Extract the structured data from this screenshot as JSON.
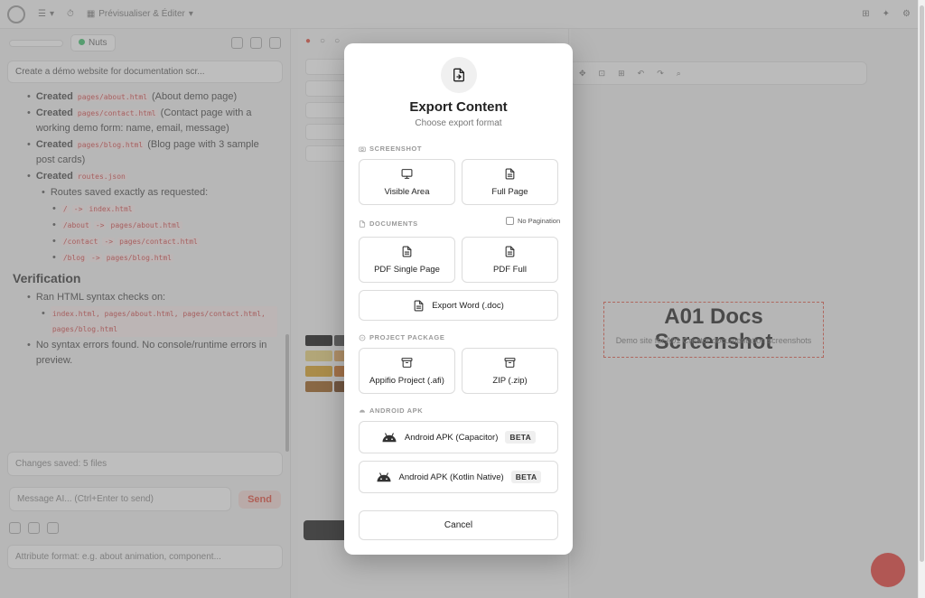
{
  "app": {
    "topbar": [
      "Prévisualiser & Éditer"
    ],
    "left": {
      "model_select": "",
      "status_label": "Nuts",
      "session_title": "Create a démo website for documentation scr...",
      "chat": {
        "created_items": [
          {
            "label": "Created",
            "file": "pages/about.html",
            "note": "(About demo page)"
          },
          {
            "label": "Created",
            "file": "pages/contact.html",
            "note": "(Contact page with a working demo form: name, email, message)"
          },
          {
            "label": "Created",
            "file": "pages/blog.html",
            "note": "(Blog page with 3 sample post cards)"
          },
          {
            "label": "Created",
            "file": "routes.json"
          }
        ],
        "routes_intro": "Routes saved exactly as requested:",
        "routes": [
          {
            "path": "/",
            "arrow": "->",
            "file": "index.html"
          },
          {
            "path": "/about",
            "arrow": "->",
            "file": "pages/about.html"
          },
          {
            "path": "/contact",
            "arrow": "->",
            "file": "pages/contact.html"
          },
          {
            "path": "/blog",
            "arrow": "->",
            "file": "pages/blog.html"
          }
        ],
        "verification_heading": "Verification",
        "verify_items": [
          "Ran HTML syntax checks on:",
          "No syntax errors found. No console/runtime errors in preview."
        ],
        "verify_files": "index.html, pages/about.html, pages/contact.html, pages/blog.html"
      },
      "changes_label": "Changes saved: 5 files",
      "input_placeholder": "Message AI... (Ctrl+Enter to send)",
      "send_label": "Send",
      "bottom_note": "Attribute format: e.g. about animation, component..."
    },
    "canvas": {
      "heading": "A01 Docs Screenshot",
      "sub": "Demo site for A01 Creator documentation screenshots"
    }
  },
  "modal": {
    "title": "Export Content",
    "subtitle": "Choose export format",
    "sections": {
      "screenshot": "SCREENSHOT",
      "documents": "DOCUMENTS",
      "project_package": "PROJECT PACKAGE",
      "android_apk": "ANDROID APK"
    },
    "no_pagination_label": "No Pagination",
    "options": {
      "visible_area": "Visible Area",
      "full_page": "Full Page",
      "pdf_single": "PDF Single Page",
      "pdf_full": "PDF Full",
      "export_word": "Export Word (.doc)",
      "appifio_project": "Appifio Project (.afi)",
      "zip": "ZIP (.zip)",
      "apk_capacitor": "Android APK (Capacitor)",
      "apk_kotlin": "Android APK (Kotlin Native)",
      "beta_badge": "BETA"
    },
    "cancel_label": "Cancel"
  },
  "colors": {
    "accent": "#e24b3b",
    "overlay": "#787878",
    "modal_bg": "#ffffff"
  },
  "icons": {
    "header": "export-file-icon",
    "screenshot_section": "camera-icon",
    "visible_area": "monitor-icon",
    "full_page": "document-icon",
    "documents_section": "document-icon",
    "pdf": "document-icon",
    "word": "document-icon",
    "project_section": "package-icon",
    "archive": "archive-box-icon",
    "android_section": "android-icon",
    "android": "android-icon"
  }
}
